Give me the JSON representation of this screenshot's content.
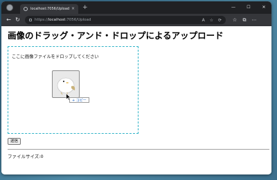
{
  "browser": {
    "tab_title": "localhost:7056/Upload",
    "tab_close": "×",
    "new_tab": "+",
    "window_controls": [
      "—",
      "☐",
      "✕"
    ],
    "url_prefix": "https://",
    "url_host": "localhost",
    "url_path": ":7056/Upload",
    "back": "←",
    "reload": "↻",
    "home": "⌂",
    "omni_icons": [
      "A",
      "☆",
      "⟳"
    ],
    "toolbar_icons": [
      "☆",
      "⧉",
      "⋯"
    ]
  },
  "page": {
    "title": "画像のドラッグ・アンド・ドロップによるアップロード",
    "drop_message": "ここに画像ファイルをドロップしてください",
    "copy_label": "+ コピー",
    "submit_label": "送信",
    "file_size_label": "ファイルサイズ:0"
  },
  "colors": {
    "dropzone_border": "#2fb3c7",
    "browser_chrome": "#202124"
  }
}
